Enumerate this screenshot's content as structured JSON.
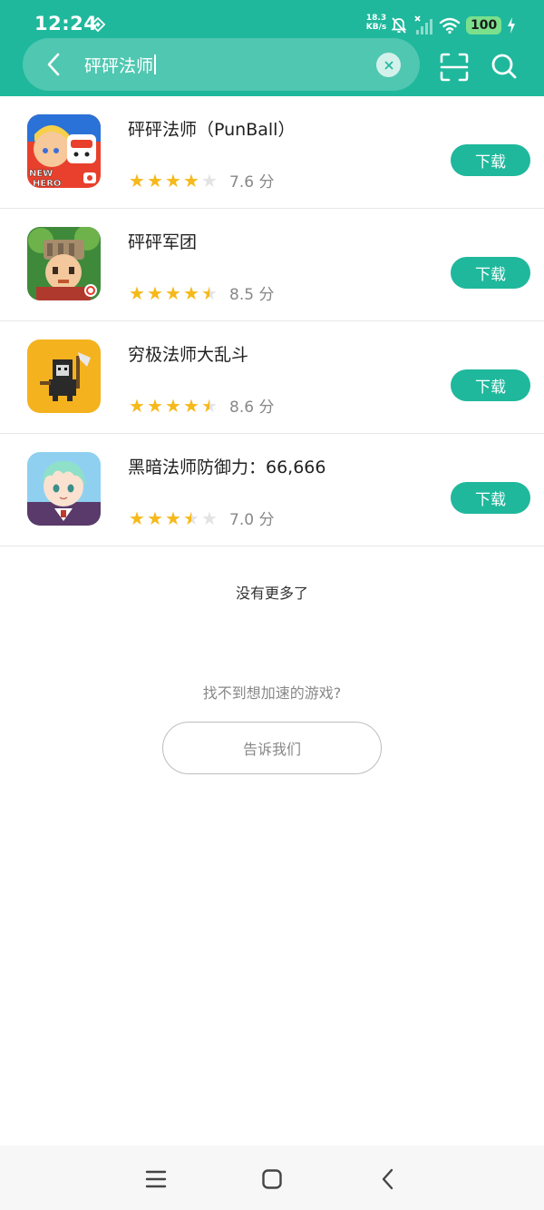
{
  "status_bar": {
    "time": "12:24",
    "net_speed_value": "18.3",
    "net_speed_unit": "KB/s",
    "battery": "100",
    "icons": [
      "diamond-icon",
      "bell-off-icon",
      "signal-icon",
      "wifi-icon",
      "battery-icon",
      "charging-icon"
    ]
  },
  "search": {
    "query": "砰砰法师",
    "icons": [
      "back-arrow-icon",
      "clear-icon",
      "scan-icon",
      "search-icon"
    ]
  },
  "colors": {
    "accent": "#1fb89c",
    "star": "#f6b91a",
    "star_empty": "#e3e3e3"
  },
  "results": [
    {
      "name": "砰砰法师（PunBall）",
      "stars": 4,
      "score": "7.6 分",
      "button": "下载"
    },
    {
      "name": "砰砰军团",
      "stars": 4.5,
      "score": "8.5 分",
      "button": "下载"
    },
    {
      "name": "穷极法师大乱斗",
      "stars": 4.5,
      "score": "8.6 分",
      "button": "下载"
    },
    {
      "name": "黑暗法师防御力：66,666",
      "stars": 3.5,
      "score": "7.0 分",
      "button": "下载"
    }
  ],
  "footer": {
    "no_more": "没有更多了",
    "not_found": "找不到想加速的游戏?",
    "tell_us": "告诉我们"
  },
  "nav": {
    "icons": [
      "menu-icon",
      "home-icon",
      "back-icon"
    ]
  }
}
